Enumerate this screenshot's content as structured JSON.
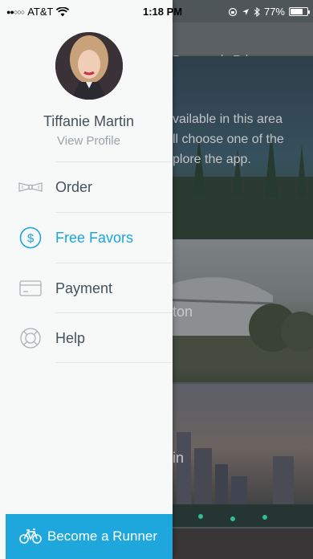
{
  "status_bar": {
    "signal": "●●○○○",
    "carrier": "AT&T",
    "time": "1:18 PM",
    "battery": "77%",
    "battery_level": 0.77
  },
  "background": {
    "address": "Dunwoody Rd",
    "card_1_lines": [
      "vailable in this area",
      "ll choose one of the",
      "plore the app."
    ],
    "card_2_city": "ton",
    "card_3_city": "in"
  },
  "drawer": {
    "user_name": "Tiffanie Martin",
    "view_profile": "View Profile",
    "menu": [
      {
        "label": "Order",
        "icon": "bow-tie-icon",
        "active": false
      },
      {
        "label": "Free Favors",
        "icon": "dollar-circle-icon",
        "active": true
      },
      {
        "label": "Payment",
        "icon": "credit-card-icon",
        "active": false
      },
      {
        "label": "Help",
        "icon": "lifebuoy-icon",
        "active": false
      }
    ],
    "runner_button": "Become a Runner"
  },
  "colors": {
    "accent": "#1ea7dc",
    "active_text": "#1aa6d9",
    "menu_text": "#45525a",
    "drawer_bg": "#f7f8f8"
  }
}
